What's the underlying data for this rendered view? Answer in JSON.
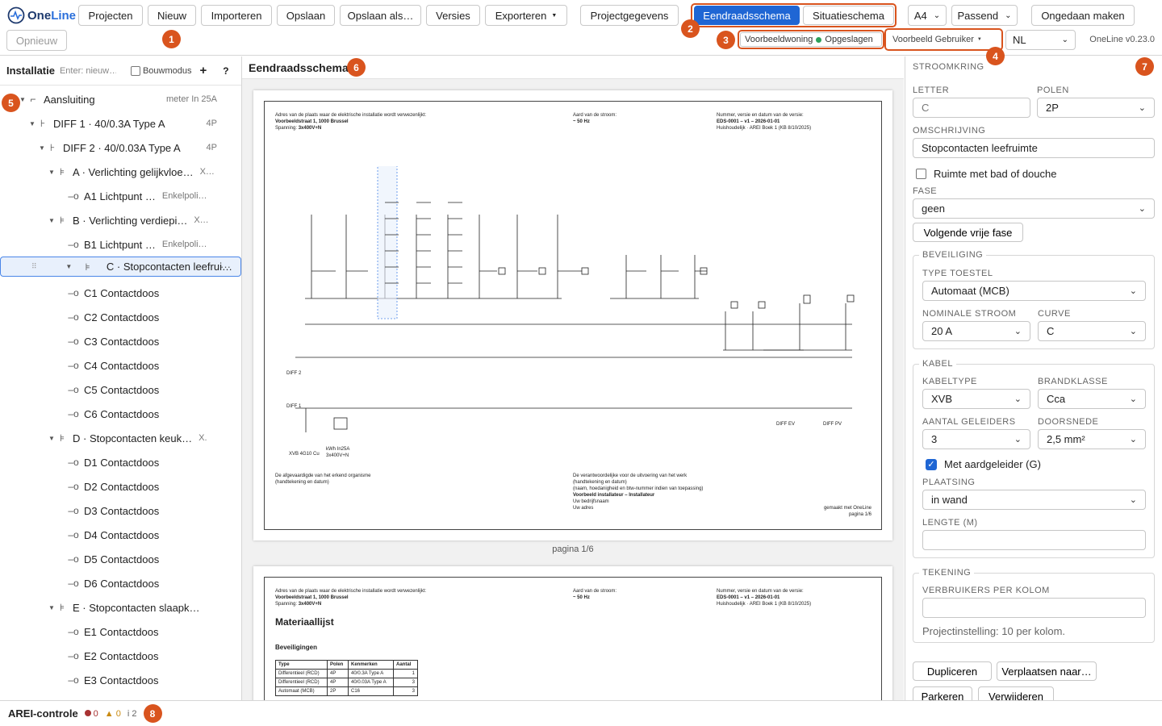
{
  "app": {
    "logo_text": "One",
    "logo_text2": "Line",
    "version": "OneLine v0.23.0"
  },
  "toolbar": {
    "projects": "Projecten",
    "new": "Nieuw",
    "import": "Importeren",
    "save": "Opslaan",
    "save_as": "Opslaan als…",
    "versions": "Versies",
    "export": "Exporteren",
    "project_data": "Projectgegevens",
    "tab_single_line": "Eendraadsschema",
    "tab_situation": "Situatieschema",
    "paper": "A4",
    "fit": "Passend",
    "undo": "Ongedaan maken",
    "redo": "Opnieuw",
    "project_name": "Voorbeeldwoning",
    "save_status": "Opgeslagen",
    "user": "Voorbeeld Gebruiker",
    "language": "NL"
  },
  "badges": [
    "1",
    "2",
    "3",
    "4",
    "5",
    "6",
    "7",
    "8"
  ],
  "left": {
    "title": "Installatie",
    "placeholder": "Enter: nieuw…",
    "build_mode": "Bouwmodus",
    "plus": "+",
    "help": "?",
    "tree": [
      {
        "label": "Aansluiting",
        "right": "meter In 25A",
        "indent": 0,
        "icon": "⌐",
        "tw": "▼"
      },
      {
        "label": "DIFF 1 · 40/0.3A Type A",
        "right": "4P",
        "indent": 1,
        "icon": "⊦",
        "tw": "▼"
      },
      {
        "label": "DIFF 2 · 40/0.03A Type A",
        "right": "4P",
        "indent": 2,
        "icon": "⊦",
        "tw": "▼"
      },
      {
        "label": "A · Verlichting gelijkvloe…",
        "meta": "X…",
        "indent": 3,
        "icon": "⊧",
        "tw": "▼"
      },
      {
        "label": "A1 Lichtpunt …",
        "meta": "Enkelpoli…",
        "indent": 4,
        "icon": "–o",
        "tw": ""
      },
      {
        "label": "B · Verlichting verdiepi…",
        "meta": "X…",
        "indent": 3,
        "icon": "⊧",
        "tw": "▼"
      },
      {
        "label": "B1 Lichtpunt …",
        "meta": "Enkelpoli…",
        "indent": 4,
        "icon": "–o",
        "tw": ""
      },
      {
        "label": "C · Stopcontacten leefrui…",
        "more": "···",
        "indent": 3,
        "icon": "⊧",
        "tw": "▼",
        "selected": true
      },
      {
        "label": "C1 Contactdoos",
        "indent": 4,
        "icon": "–o",
        "tw": ""
      },
      {
        "label": "C2 Contactdoos",
        "indent": 4,
        "icon": "–o",
        "tw": ""
      },
      {
        "label": "C3 Contactdoos",
        "indent": 4,
        "icon": "–o",
        "tw": ""
      },
      {
        "label": "C4 Contactdoos",
        "indent": 4,
        "icon": "–o",
        "tw": ""
      },
      {
        "label": "C5 Contactdoos",
        "indent": 4,
        "icon": "–o",
        "tw": ""
      },
      {
        "label": "C6 Contactdoos",
        "indent": 4,
        "icon": "–o",
        "tw": ""
      },
      {
        "label": "D · Stopcontacten keuk…",
        "meta": "X.",
        "indent": 3,
        "icon": "⊧",
        "tw": "▼"
      },
      {
        "label": "D1 Contactdoos",
        "indent": 4,
        "icon": "–o",
        "tw": ""
      },
      {
        "label": "D2 Contactdoos",
        "indent": 4,
        "icon": "–o",
        "tw": ""
      },
      {
        "label": "D3 Contactdoos",
        "indent": 4,
        "icon": "–o",
        "tw": ""
      },
      {
        "label": "D4 Contactdoos",
        "indent": 4,
        "icon": "–o",
        "tw": ""
      },
      {
        "label": "D5 Contactdoos",
        "indent": 4,
        "icon": "–o",
        "tw": ""
      },
      {
        "label": "D6 Contactdoos",
        "indent": 4,
        "icon": "–o",
        "tw": ""
      },
      {
        "label": "E · Stopcontacten slaapk…",
        "indent": 3,
        "icon": "⊧",
        "tw": "▼"
      },
      {
        "label": "E1 Contactdoos",
        "indent": 4,
        "icon": "–o",
        "tw": ""
      },
      {
        "label": "E2 Contactdoos",
        "indent": 4,
        "icon": "–o",
        "tw": ""
      },
      {
        "label": "E3 Contactdoos",
        "indent": 4,
        "icon": "–o",
        "tw": ""
      }
    ]
  },
  "center": {
    "title": "Eendraadsschema",
    "page1": {
      "address_label": "Adres van de plaats waar de elektrische installatie wordt verwezenlijkt:",
      "address": "Voorbeeldstraat 1, 1000 Brussel",
      "voltage_label": "Spanning:",
      "voltage": "3x400V+N",
      "current_label": "Aard van de stroom:",
      "current": "~ 50 Hz",
      "number_label": "Nummer, versie en datum van de versie:",
      "number": "EDS-0001 – v1 – 2026-01-01",
      "domestic": "Huishoudelijk · AREI Boek 1 (KB 8/10/2025)",
      "approved_label": "De afgevaardigde van het erkend organisme",
      "approved_sub": "(handtekening en datum)",
      "resp_label": "De verantwoordelijke voor de uitvoering van het werk",
      "resp_sub1": "(handtekening en datum)",
      "resp_sub2": "(naam, hoedanigheid en btw-nummer indien van toepassing)",
      "installer": "Voorbeeld installateur – Installateur",
      "company": "Uw bedrijfsnaam",
      "addr2": "Uw adres",
      "made_with": "gemaakt met OneLine",
      "page": "pagina 1/6",
      "diff1": "DIFF 1",
      "diff2": "DIFF 2",
      "diffev": "DIFF EV",
      "diffpv": "DIFF PV",
      "main_cable": "XVB 4G10 Cu",
      "meter": "kWh",
      "meter_sub": "In25A",
      "meter_sub2": "3x400V+N"
    },
    "page_label": "pagina 1/6",
    "page2": {
      "title": "Materiaallijst",
      "section": "Beveiligingen",
      "headers": [
        "Type",
        "Polen",
        "Kenmerken",
        "Aantal"
      ],
      "rows": [
        [
          "Differentieel (RCD)",
          "4P",
          "40/0.3A Type A",
          "1"
        ],
        [
          "Differentieel (RCD)",
          "4P",
          "40/0.03A Type A",
          "3"
        ],
        [
          "Automaat (MCB)",
          "2P",
          "C16",
          "3"
        ]
      ]
    }
  },
  "right": {
    "section": "Stroomkring",
    "letter_label": "Letter",
    "letter_value": "C",
    "poles_label": "Polen",
    "poles_value": "2P",
    "desc_label": "Omschrijving",
    "desc_value": "Stopcontacten leefruimte",
    "bath_label": "Ruimte met bad of douche",
    "phase_label": "Fase",
    "phase_value": "geen",
    "next_phase": "Volgende vrije fase",
    "protection_legend": "Beveiliging",
    "device_label": "Type toestel",
    "device_value": "Automaat (MCB)",
    "nominal_label": "Nominale stroom",
    "nominal_value": "20 A",
    "curve_label": "Curve",
    "curve_value": "C",
    "cable_legend": "Kabel",
    "cable_type_label": "Kabeltype",
    "cable_type_value": "XVB",
    "fire_label": "Brandklasse",
    "fire_value": "Cca",
    "conductors_label": "Aantal geleiders",
    "conductors_value": "3",
    "section_label": "Doorsnede",
    "section_value": "2,5 mm²",
    "earth_label": "Met aardgeleider (G)",
    "placement_label": "Plaatsing",
    "placement_value": "in wand",
    "length_label": "Lengte (m)",
    "length_value": "",
    "drawing_legend": "Tekening",
    "per_column_label": "Verbruikers per kolom",
    "per_column_value": "",
    "project_setting": "Projectinstelling: 10 per kolom.",
    "duplicate": "Dupliceren",
    "move": "Verplaatsen naar…",
    "park": "Parkeren",
    "delete": "Verwijderen"
  },
  "status": {
    "title": "AREI-controle",
    "errors": "0",
    "warnings": "0",
    "info": "i 2"
  },
  "colors": {
    "accent": "#1f66d4",
    "highlight": "#d9541e",
    "ok": "#2ca05a"
  }
}
